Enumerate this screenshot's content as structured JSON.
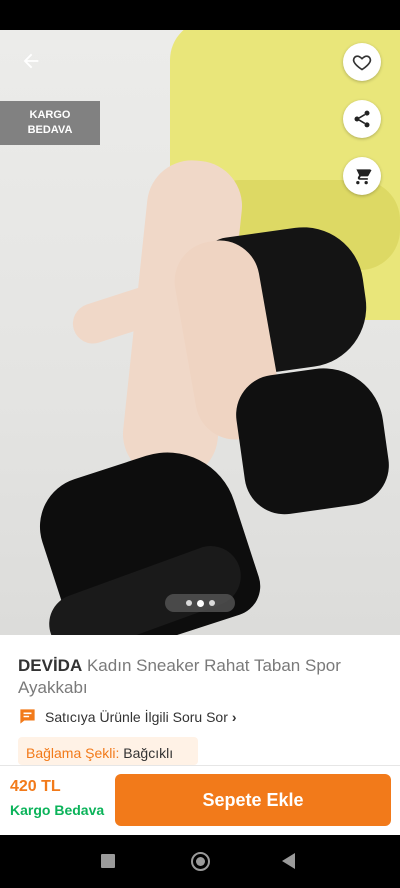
{
  "product_image": {
    "badge_line1": "KARGO",
    "badge_line2": "BEDAVA",
    "pager_count": 3,
    "pager_active_index": 1
  },
  "actions": {
    "back_icon": "back-arrow-icon",
    "favorite_icon": "heart-icon",
    "share_icon": "share-icon",
    "cart_icon": "cart-icon"
  },
  "product": {
    "brand": "DEVİDA",
    "name": "Kadın Sneaker Rahat Taban Spor Ayakkabı",
    "question_link": "Satıcıya Ürünle İlgili Soru Sor",
    "attribute_label": "Bağlama Şekli:",
    "attribute_value": "Bağcıklı"
  },
  "checkout": {
    "price": "420 TL",
    "shipping": "Kargo Bedava",
    "button_label": "Sepete Ekle"
  },
  "colors": {
    "accent": "#f27a1a",
    "shipping_green": "#0bb35a",
    "attribute_bg": "#fff2e6"
  }
}
